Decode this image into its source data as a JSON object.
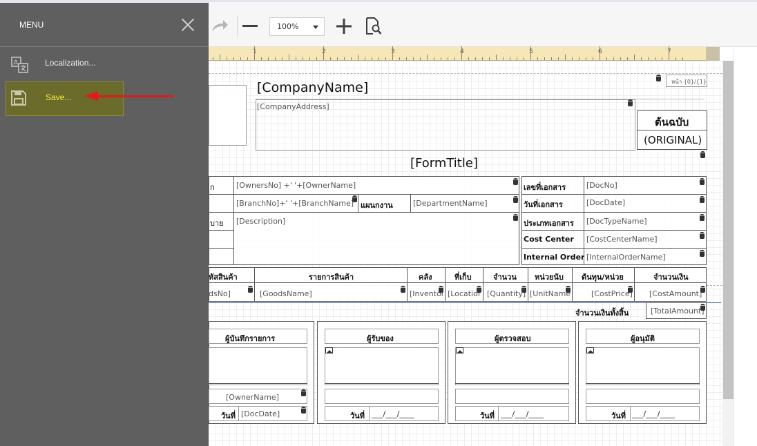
{
  "menu": {
    "title": "MENU",
    "items": [
      {
        "label": "Localization...",
        "icon": "localization-icon"
      },
      {
        "label": "Save...",
        "icon": "save-icon",
        "highlighted": true
      }
    ]
  },
  "toolbar": {
    "zoom": "100%"
  },
  "ruler": {
    "marks": [
      "1",
      "2",
      "3",
      "4",
      "5",
      "6",
      "7"
    ]
  },
  "report": {
    "page_label": "หน้า {0}/{1}",
    "company_name": "[CompanyName]",
    "company_address": "[CompanyAddress]",
    "original_th": "ต้นฉบับ",
    "original_en": "(ORIGINAL)",
    "form_title": "[FormTitle]",
    "left_fields": {
      "owner_label_partial": "ก",
      "owners_no": "[OwnersNo] +'",
      "owner_name": "'+[OwnerName]",
      "branch_no": "[BranchNo]+'",
      "branch_name": "'+[BranchName]",
      "department_label": "แผนกงาน",
      "department_name": "[DepartmentName]",
      "description_label_partial": "บาย",
      "description": "[Description]"
    },
    "right_fields": [
      {
        "label": "เลขที่เอกสาร",
        "value": "[DocNo]"
      },
      {
        "label": "วันที่เอกสาร",
        "value": "[DocDate]"
      },
      {
        "label": "ประเภทเอกสาร",
        "value": "[DocTypeName]"
      },
      {
        "label": "Cost Center",
        "value": "[CostCenterName]"
      },
      {
        "label": "Internal Order",
        "value": "[InternalOrderName]"
      }
    ],
    "table_headers": [
      "หัสสินค้า",
      "รายการสินค้า",
      "คลัง",
      "ที่เก็บ",
      "จำนวน",
      "หน่วยนับ",
      "ต้นทุน/หน่วย",
      "จำนวนเงิน"
    ],
    "table_cells": [
      "dsNo]",
      "[GoodsName]",
      "[Inventor",
      "[Location",
      "[Quantity]",
      "[UnitName]",
      "[CostPrice]",
      "[CostAmount]"
    ],
    "total_label": "จำนวนเงินทั้งสิ้น",
    "total_value": "[TotalAmount]",
    "signatures": [
      {
        "title": "ผู้บันทึกรายการ",
        "name": "[OwnerName]",
        "date_label": "วันที่",
        "date": "[DocDate]"
      },
      {
        "title": "ผู้รับของ",
        "date_label": "วันที่",
        "date": "___/___/____"
      },
      {
        "title": "ผู้ตรวจสอบ",
        "date_label": "วันที่",
        "date": "___/___/____"
      },
      {
        "title": "ผู้อนุมัติ",
        "date_label": "วันที่",
        "date": "___/___/____"
      }
    ]
  }
}
